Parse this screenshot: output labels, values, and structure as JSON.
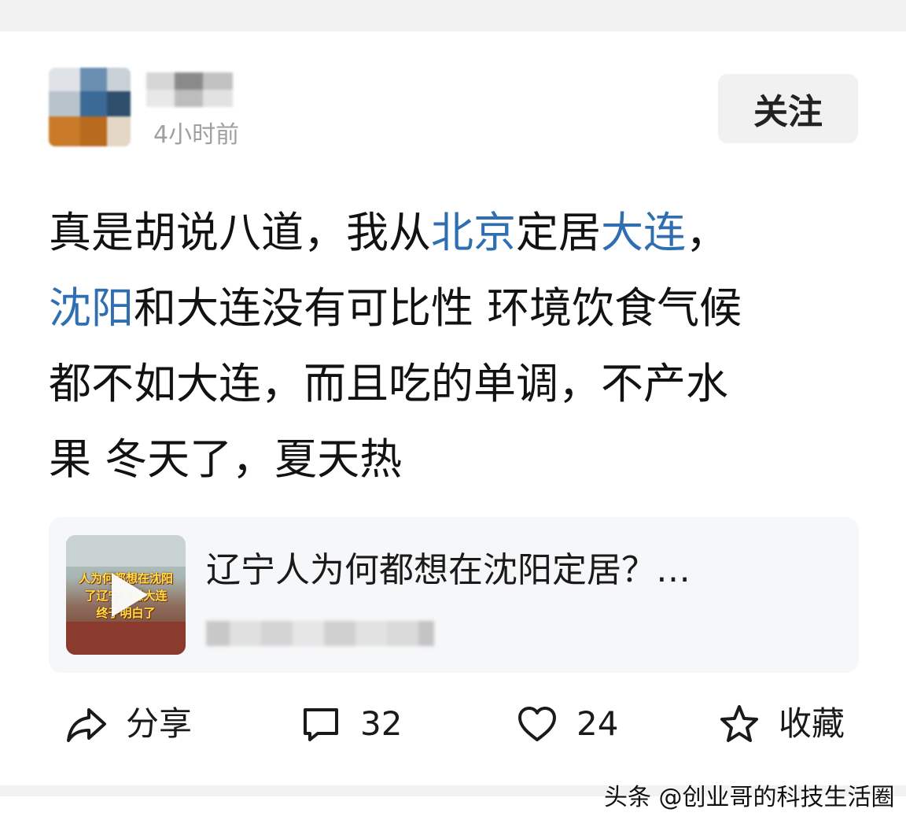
{
  "post": {
    "timestamp": "4小时前",
    "follow_label": "关注",
    "text": {
      "line1_a": "真是胡说八道，我从",
      "line1_link1": "北京",
      "line1_b": "定居",
      "line1_link2": "大连",
      "line1_c": "，",
      "line2_link": "沈阳",
      "line2_a": "和大连没有可比性 环境饮食气候",
      "line3": "都不如大连，而且吃的单调，不产水",
      "line4": "果 冬天了，夏天热"
    },
    "link_color": "#2f6fb1"
  },
  "link_card": {
    "title": "辽宁人为何都想在沈阳定居？…",
    "thumbnail_caption": [
      "人为何都想在沈阳",
      "了辽宁人嫌大连",
      "终于明白了"
    ],
    "play_icon": "play-icon"
  },
  "actions": {
    "share": {
      "icon": "share-icon",
      "label": "分享"
    },
    "comment": {
      "icon": "comment-icon",
      "count": "32"
    },
    "like": {
      "icon": "heart-icon",
      "count": "24"
    },
    "favorite": {
      "icon": "star-icon",
      "label": "收藏"
    }
  },
  "watermark": "头条 @创业哥的科技生活圈"
}
